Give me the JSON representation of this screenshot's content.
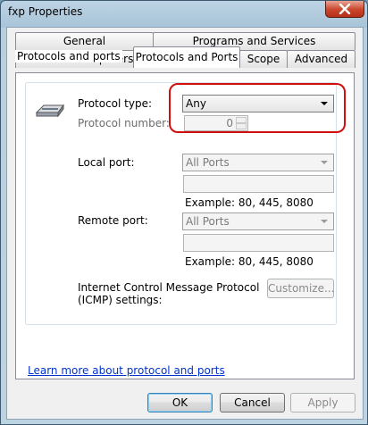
{
  "window": {
    "title": "fxp Properties"
  },
  "tabs_row1": [
    "General",
    "Programs and Services"
  ],
  "tabs_row2": [
    "Users and Computers",
    "Protocols and Ports",
    "Scope",
    "Advanced"
  ],
  "active_tab": "Protocols and Ports",
  "group": {
    "title": "Protocols and ports",
    "protocol_type_label": "Protocol type:",
    "protocol_type_value": "Any",
    "protocol_number_label": "Protocol number:",
    "protocol_number_value": "0",
    "local_port_label": "Local port:",
    "local_port_value": "All Ports",
    "local_example": "Example: 80, 445, 8080",
    "remote_port_label": "Remote port:",
    "remote_port_value": "All Ports",
    "remote_example": "Example: 80, 445, 8080",
    "icmp_label_line1": "Internet Control Message Protocol",
    "icmp_label_line2": "(ICMP) settings:",
    "customize_label": "Customize..."
  },
  "learn_more_link": "Learn more about protocol and ports",
  "buttons": {
    "ok": "OK",
    "cancel": "Cancel",
    "apply": "Apply"
  },
  "colors": {
    "highlight": "#d10f0f",
    "link": "#0033cc"
  },
  "icons": {
    "protocol": "network-plug-icon",
    "close": "close-icon"
  }
}
